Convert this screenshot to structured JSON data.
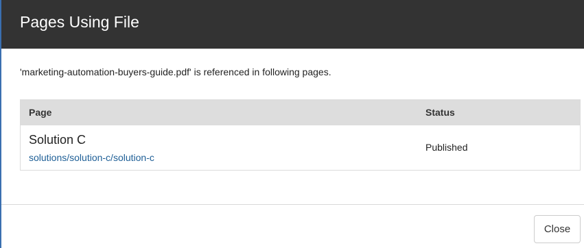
{
  "dialog": {
    "title": "Pages Using File",
    "message": "'marketing-automation-buyers-guide.pdf' is referenced in following pages."
  },
  "table": {
    "columns": [
      "Page",
      "Status"
    ],
    "rows": [
      {
        "page_title": "Solution C",
        "page_path": "solutions/solution-c/solution-c",
        "status": "Published"
      }
    ]
  },
  "footer": {
    "close_label": "Close"
  },
  "colors": {
    "header_bg": "#333333",
    "link": "#1d5e96",
    "table_header_bg": "#dddddd"
  }
}
